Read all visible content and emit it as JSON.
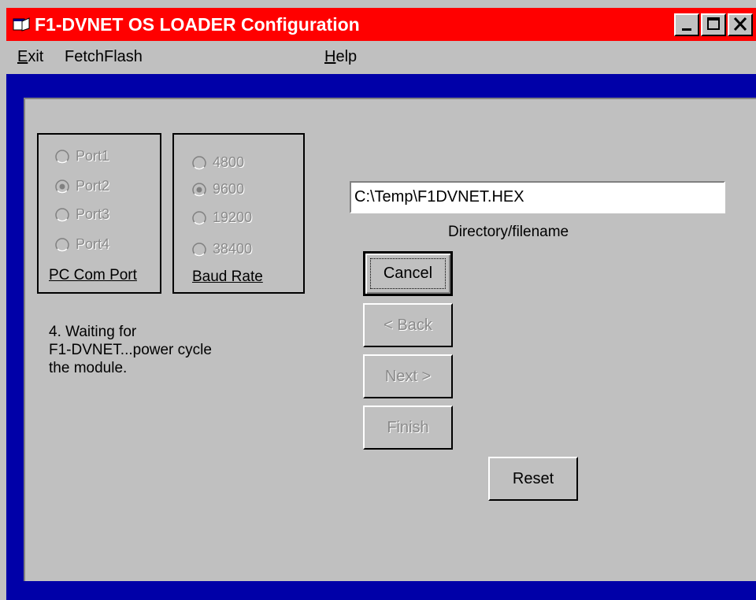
{
  "window": {
    "title": "F1-DVNET OS LOADER Configuration",
    "title_color": "#ff0000",
    "client_color": "#0000a8",
    "controls": [
      "minimize-icon",
      "maximize-icon",
      "close-icon"
    ]
  },
  "menu": {
    "items": [
      {
        "label": "Exit",
        "mnemonic": "E"
      },
      {
        "label": "FetchFlash",
        "mnemonic": ""
      },
      {
        "label": "Help",
        "mnemonic": "H"
      }
    ]
  },
  "com_port": {
    "caption": "PC Com Port",
    "options": [
      "Port1",
      "Port2",
      "Port3",
      "Port4"
    ],
    "selected": "Port2",
    "enabled": false
  },
  "baud_rate": {
    "caption": "Baud Rate",
    "options": [
      "4800",
      "9600",
      "19200",
      "38400"
    ],
    "selected": "9600",
    "enabled": false
  },
  "status": {
    "lines": [
      "4. Waiting for",
      "F1-DVNET...power cycle",
      "the module."
    ]
  },
  "file": {
    "value": "C:\\Temp\\F1DVNET.HEX",
    "caption": "Directory/filename"
  },
  "buttons": {
    "cancel": "Cancel",
    "back": "< Back",
    "next": "Next >",
    "finish": "Finish",
    "reset": "Reset"
  }
}
